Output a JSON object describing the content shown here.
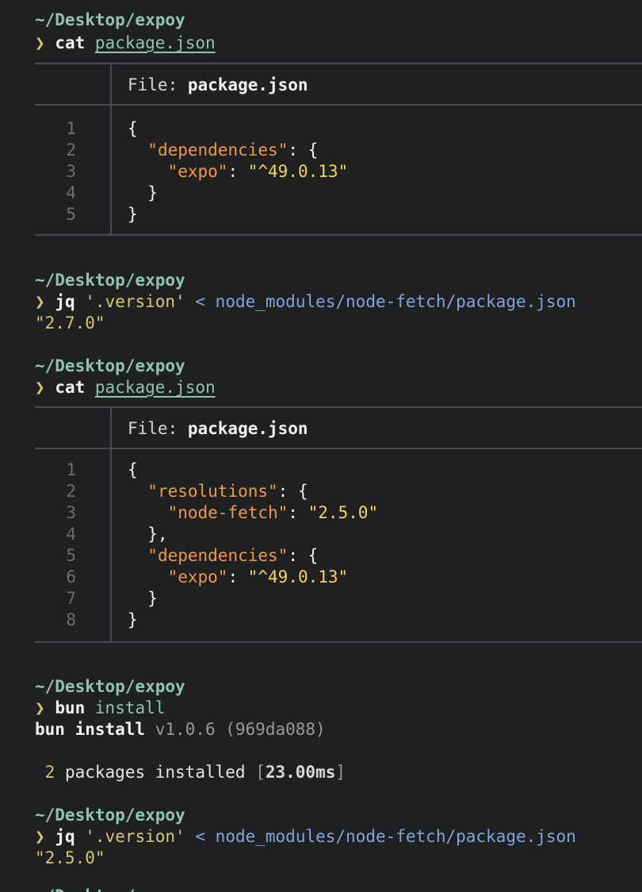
{
  "blocks": [
    {
      "cwd": "~/Desktop/expoy",
      "prompt_symbol": "❯",
      "command": "cat",
      "argument": "package.json"
    },
    {
      "cwd": "~/Desktop/expoy",
      "prompt_symbol": "❯",
      "command": "jq",
      "argument": "'.version'",
      "redirect": "<",
      "target": "node_modules/node-fetch/package.json",
      "output": "\"2.7.0\""
    },
    {
      "cwd": "~/Desktop/expoy",
      "prompt_symbol": "❯",
      "command": "cat",
      "argument": "package.json"
    },
    {
      "cwd": "~/Desktop/expoy",
      "prompt_symbol": "❯",
      "command": "bun",
      "argument": "install"
    },
    {
      "cwd": "~/Desktop/expoy",
      "prompt_symbol": "❯",
      "command": "jq",
      "argument": "'.version'",
      "redirect": "<",
      "target": "node_modules/node-fetch/package.json",
      "output": "\"2.5.0\""
    }
  ],
  "file_view_1": {
    "header_label": "File: ",
    "file_name": "package.json",
    "lines": [
      {
        "n": "1",
        "text": "{"
      },
      {
        "n": "2",
        "key": "\"dependencies\"",
        "rest": ": {"
      },
      {
        "n": "3",
        "key": "\"expo\"",
        "sep": ": ",
        "val": "\"^49.0.13\""
      },
      {
        "n": "4",
        "text": "  }"
      },
      {
        "n": "5",
        "text": "}"
      }
    ]
  },
  "file_view_2": {
    "header_label": "File: ",
    "file_name": "package.json",
    "lines": [
      {
        "n": "1",
        "text": "{"
      },
      {
        "n": "2",
        "key": "\"resolutions\"",
        "rest": ": {"
      },
      {
        "n": "3",
        "key": "\"node-fetch\"",
        "sep": ": ",
        "val": "\"2.5.0\""
      },
      {
        "n": "4",
        "text": "  },"
      },
      {
        "n": "5",
        "key": "\"dependencies\"",
        "rest": ": {"
      },
      {
        "n": "6",
        "key": "\"expo\"",
        "sep": ": ",
        "val": "\"^49.0.13\""
      },
      {
        "n": "7",
        "text": "  }"
      },
      {
        "n": "8",
        "text": "}"
      }
    ]
  },
  "bun_output": {
    "title": "bun install",
    "version": "v1.0.6",
    "hash": "(969da088)",
    "count": "2",
    "message": "packages installed",
    "time_open": "[",
    "time": "23.00ms",
    "time_close": "]"
  },
  "trailing_cwd": "~/Desktop/expoy"
}
